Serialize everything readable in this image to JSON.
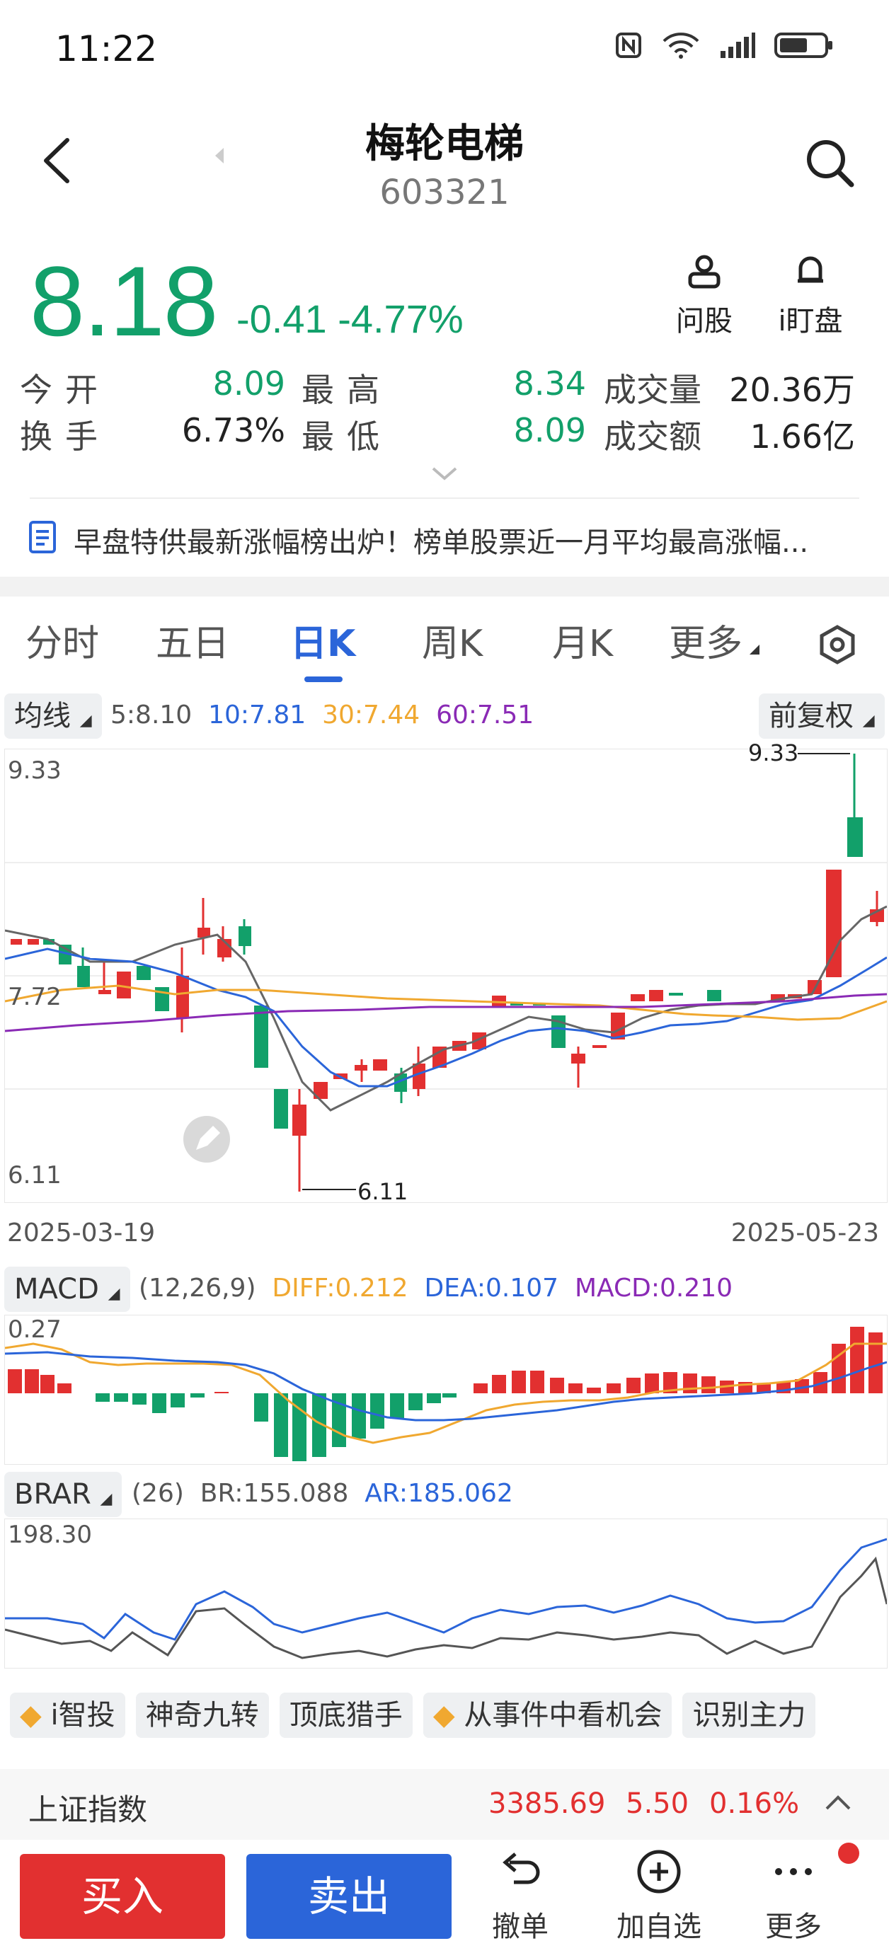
{
  "status_bar": {
    "time": "11:22"
  },
  "header": {
    "title": "梅轮电梯",
    "code": "603321"
  },
  "quote": {
    "price": "8.18",
    "change": "-0.41",
    "change_pct": "-4.77%",
    "actions": [
      {
        "label": "问股",
        "icon": "person-icon"
      },
      {
        "label": "i盯盘",
        "icon": "bell-icon"
      }
    ]
  },
  "stats": {
    "open_label": "今开",
    "open": "8.09",
    "high_label": "最高",
    "high": "8.34",
    "volume_label": "成交量",
    "volume": "20.36万",
    "turnover_label": "换手",
    "turnover": "6.73%",
    "low_label": "最低",
    "low": "8.09",
    "amount_label": "成交额",
    "amount": "1.66亿"
  },
  "news": {
    "text": "早盘特供最新涨幅榜出炉！榜单股票近一月平均最高涨幅..."
  },
  "tabs": [
    "分时",
    "五日",
    "日K",
    "周K",
    "月K",
    "更多"
  ],
  "active_tab": "日K",
  "ma": {
    "selector": "均线",
    "ma5": "5:8.10",
    "ma10": "10:7.81",
    "ma30": "30:7.44",
    "ma60": "60:7.51",
    "adjust": "前复权"
  },
  "kline": {
    "y_top": "9.33",
    "y_mid": "7.72",
    "y_bottom": "6.11",
    "high_mark": "9.33",
    "low_mark": "6.11",
    "date_start": "2025-03-19",
    "date_end": "2025-05-23"
  },
  "macd": {
    "selector": "MACD",
    "params": "(12,26,9)",
    "diff": "DIFF:0.212",
    "dea": "DEA:0.107",
    "macd": "MACD:0.210",
    "y_top": "0.27"
  },
  "brar": {
    "selector": "BRAR",
    "params": "(26)",
    "br": "BR:155.088",
    "ar": "AR:185.062",
    "y_top": "198.30"
  },
  "tools": [
    "i智投",
    "神奇九转",
    "顶底猎手",
    "从事件中看机会",
    "识别主力"
  ],
  "index_bar": {
    "name": "上证指数",
    "value": "3385.69",
    "change": "5.50",
    "pct": "0.16%"
  },
  "bottom": {
    "buy": "买入",
    "sell": "卖出",
    "cancel": "撤单",
    "add": "加自选",
    "more": "更多"
  },
  "colors": {
    "up": "#e23030",
    "down": "#12a06a",
    "accent": "#2b65d9",
    "ma5": "#666666",
    "ma10": "#2b65d9",
    "ma30": "#f0a830",
    "ma60": "#8a2ab5"
  }
}
